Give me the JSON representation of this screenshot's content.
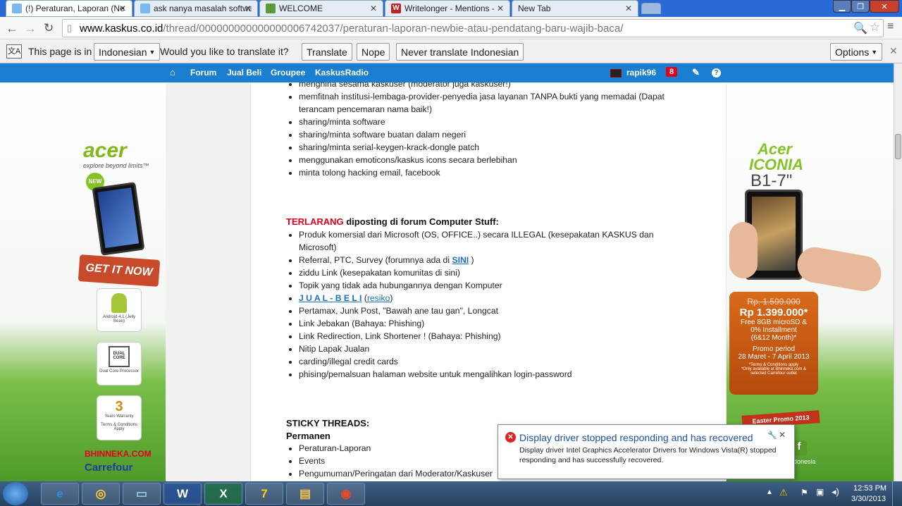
{
  "browser": {
    "tabs": [
      {
        "title": "(!) Peraturan, Laporan (Ne",
        "active": true
      },
      {
        "title": "ask nanya masalah softwa",
        "active": false
      },
      {
        "title": "WELCOME",
        "active": false
      },
      {
        "title": "Writelonger - Mentions - ",
        "active": false
      },
      {
        "title": "New Tab",
        "active": false
      }
    ],
    "url_host": "www.kaskus.co.id",
    "url_path": "/thread/000000000000000006742037/peraturan-laporan-newbie-atau-pendatang-baru-wajib-baca/"
  },
  "translate_bar": {
    "lead": "This page is in",
    "language": "Indonesian",
    "question": "Would you like to translate it?",
    "translate": "Translate",
    "nope": "Nope",
    "never": "Never translate Indonesian",
    "options": "Options"
  },
  "kaskus_nav": {
    "items": [
      "Forum",
      "Jual Beli",
      "Groupee",
      "KaskusRadio"
    ],
    "username": "rapik96",
    "notif_count": "8"
  },
  "post": {
    "top_items": [
      "menghina sesama kaskuser (moderator juga kaskuser!)",
      "memfitnah institusi-lembaga-provider-penyedia jasa layanan TANPA bukti yang memadai (Dapat",
      "terancam pencemaran nama baik!)",
      "sharing/minta software",
      "sharing/minta software buatan dalam negeri",
      "sharing/minta serial-keygen-krack-dongle patch",
      "menggunakan emoticons/kaskus icons secara berlebihan",
      "minta tolong hacking email, facebook"
    ],
    "forbidden_red": "TERLARANG",
    "forbidden_rest": "diposting di forum Computer Stuff:",
    "forbidden_items": [
      "Produk komersial dari Microsoft (OS, OFFICE..) secara ILLEGAL (kesepakatan KASKUS dan",
      "Microsoft)",
      "Referral, PTC, Survey (forumnya ada di ",
      "ziddu Link (kesepakatan komunitas di sini)",
      "Topik yang tidak ada hubungannya dengan Komputer",
      "J U A L - B E L I",
      "Pertamax, Junk Post, \"Bawah ane tau gan\", Longcat",
      "Link Jebakan (Bahaya: Phishing)",
      "Link Redirection, Link Shortener ! (Bahaya: Phishing)",
      "Nitip Lapak Jualan",
      "carding/illegal credit cards",
      "phising/pemalsuan halaman website untuk mengalihkan login-password"
    ],
    "sini_link": "SINI",
    "resiko_link": "resiko",
    "sticky_title": "STICKY THREADS:",
    "permanen": "Permanen",
    "sticky_items": [
      "Peraturan-Laporan",
      "Events",
      "Pengumuman/Peringatan dari Moderator/Kaskuser"
    ]
  },
  "left_ad": {
    "brand": "acer",
    "tagline": "explore beyond limits™",
    "new_badge": "NEW",
    "cta": "GET IT NOW",
    "feature1": "Android 4.1 (Jelly Bean)",
    "feature2": "Dual Core Processor",
    "feature3": "Terms & Conditions Apply",
    "dualcore": "DUAL CORE",
    "years": "3",
    "warranty": "Years Warranty",
    "bhinneka": "BHINNEKA.COM",
    "carrefour": "Carrefour"
  },
  "right_ad": {
    "brand1": "Acer",
    "brand2": "ICONIA",
    "model": "B1-7\"",
    "old_price": "Rp. 1.599.000",
    "new_price": "Rp 1.399.000*",
    "promo1": "Free 8GB microSD &",
    "promo2": "0% Installment",
    "promo3": "(6&12 Month)*",
    "period_label": "Promo period",
    "period": "28 Maret - 7 April 2013",
    "terms1": "*Terms & Conditions apply",
    "terms2": "*Only available at Bhinneka.com &",
    "terms3": "selected Carrefour outlet",
    "easter": "Easter Promo 2013",
    "footer": "donesia"
  },
  "notification": {
    "title": "Display driver stopped responding and has recovered",
    "body1": "Display driver Intel Graphics Accelerator Drivers for Windows Vista(R) stopped",
    "body2": "responding and has successfully recovered."
  },
  "taskbar": {
    "time": "12:53 PM",
    "date": "3/30/2013"
  },
  "colors": {
    "kaskus_blue": "#1a7fd1",
    "forbidden_red": "#e3001b",
    "link_blue": "#1a6fc0"
  }
}
